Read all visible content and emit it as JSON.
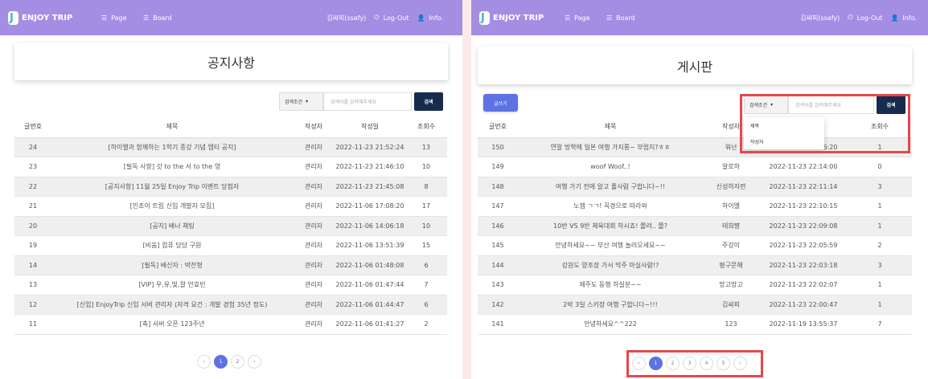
{
  "brand": "ENJOY TRIP",
  "nav": {
    "page": "Page",
    "board": "Board",
    "user": "김싸피(ssafy)",
    "logout": "Log-Out",
    "info": "Info."
  },
  "left": {
    "title": "공지사항",
    "search": {
      "select_label": "검색조건",
      "placeholder": "검색어를 입력해주세요",
      "button": "검색"
    },
    "columns": [
      "글번호",
      "제목",
      "작성자",
      "작성일",
      "조회수"
    ],
    "rows": [
      {
        "no": "24",
        "title": "[하이엘과 함께하는 1학기 종강 기념 엠티 공지]",
        "author": "관리자",
        "date": "2022-11-23 21:52:24",
        "views": "13"
      },
      {
        "no": "23",
        "title": "[필독 사항] 갓 to the 서 to the 영",
        "author": "관리자",
        "date": "2022-11-23 21:46:10",
        "views": "10"
      },
      {
        "no": "22",
        "title": "[공지사항] 11월 25일 Enjoy Trip 이벤트 당첨자",
        "author": "관리자",
        "date": "2022-11-23 21:45:08",
        "views": "8"
      },
      {
        "no": "21",
        "title": "[인조이 트립 신입 개발자 모집]",
        "author": "관리자",
        "date": "2022-11-06 17:08:20",
        "views": "17"
      },
      {
        "no": "20",
        "title": "[공지] 배너 채팅",
        "author": "관리자",
        "date": "2022-11-06 14:06:18",
        "views": "10"
      },
      {
        "no": "19",
        "title": "[비움] 컴퓨 당당 구원",
        "author": "관리자",
        "date": "2022-11-06 13:51:39",
        "views": "15"
      },
      {
        "no": "14",
        "title": "[필독] 배신자 : 박찬형",
        "author": "관리자",
        "date": "2022-11-06 01:48:08",
        "views": "6"
      },
      {
        "no": "13",
        "title": "[VIP] 우,유,빛,깔 안효빈",
        "author": "관리자",
        "date": "2022-11-06 01:47:44",
        "views": "7"
      },
      {
        "no": "12",
        "title": "[신입] EnjoyTrip 신입 서버 관리자 (자격 요건 : 개발 경험 35년 정도)",
        "author": "관리자",
        "date": "2022-11-06 01:44:47",
        "views": "6"
      },
      {
        "no": "11",
        "title": "[축] 서버 오픈 123주년",
        "author": "관리자",
        "date": "2022-11-06 01:41:27",
        "views": "2"
      }
    ],
    "pagination": {
      "prev": "‹",
      "pages": [
        "1",
        "2"
      ],
      "next": "›",
      "active": "1"
    }
  },
  "right": {
    "title": "게시판",
    "write_button": "글쓰기",
    "search": {
      "select_label": "검색조건",
      "placeholder": "검색어를 입력해주세요",
      "button": "검색"
    },
    "dropdown_options": [
      "제목",
      "작성자"
    ],
    "columns": [
      "글번호",
      "제목",
      "작성자",
      "작성일",
      "조회수"
    ],
    "rows": [
      {
        "no": "150",
        "title": "연말 방학에 일본 여행 가지롱~ 부럽지?ㅎㅎ",
        "author": "워넌",
        "date": "2022-11-23 22:16:20",
        "views": "1"
      },
      {
        "no": "149",
        "title": "woof Woof..!",
        "author": "알로하",
        "date": "2022-11-23 22:14:00",
        "views": "0"
      },
      {
        "no": "148",
        "title": "여행 가기 전에 알고 풀사람 구합니다~!!",
        "author": "신성하지련",
        "date": "2022-11-23 22:11:14",
        "views": "3"
      },
      {
        "no": "147",
        "title": "노잼 ㄱㄱ! 꼭경으로 따라와",
        "author": "하이엘",
        "date": "2022-11-23 22:10:15",
        "views": "1"
      },
      {
        "no": "146",
        "title": "10반 VS 9반 체육대회 하시죠! 쫄려.. 쫄?",
        "author": "테희쨩",
        "date": "2022-11-23 22:09:08",
        "views": "1"
      },
      {
        "no": "145",
        "title": "안녕하세요~~ 부산 여행 놀러오세요~~",
        "author": "주강이",
        "date": "2022-11-23 22:05:59",
        "views": "2"
      },
      {
        "no": "144",
        "title": "강원도 양조장 가서 막주 마실사람!?",
        "author": "평구문해",
        "date": "2022-11-23 22:03:18",
        "views": "3"
      },
      {
        "no": "143",
        "title": "제주도 동행 하실분~~",
        "author": "망고망고",
        "date": "2022-11-23 22:02:07",
        "views": "1"
      },
      {
        "no": "142",
        "title": "2박 3일 스키장 여행 구합니다~!!!",
        "author": "김싸피",
        "date": "2022-11-23 22:00:47",
        "views": "1"
      },
      {
        "no": "141",
        "title": "안녕하세요^^222",
        "author": "123",
        "date": "2022-11-19 13:55:37",
        "views": "7"
      }
    ],
    "pagination": {
      "prev": "‹",
      "pages": [
        "1",
        "2",
        "3",
        "4",
        "5"
      ],
      "next": "›",
      "active": "1"
    }
  },
  "colors": {
    "nav": "#a48ee4",
    "accent": "#5e72e4",
    "search_button": "#172b4d",
    "highlight": "#e4484c",
    "background": "#fce9ea"
  }
}
